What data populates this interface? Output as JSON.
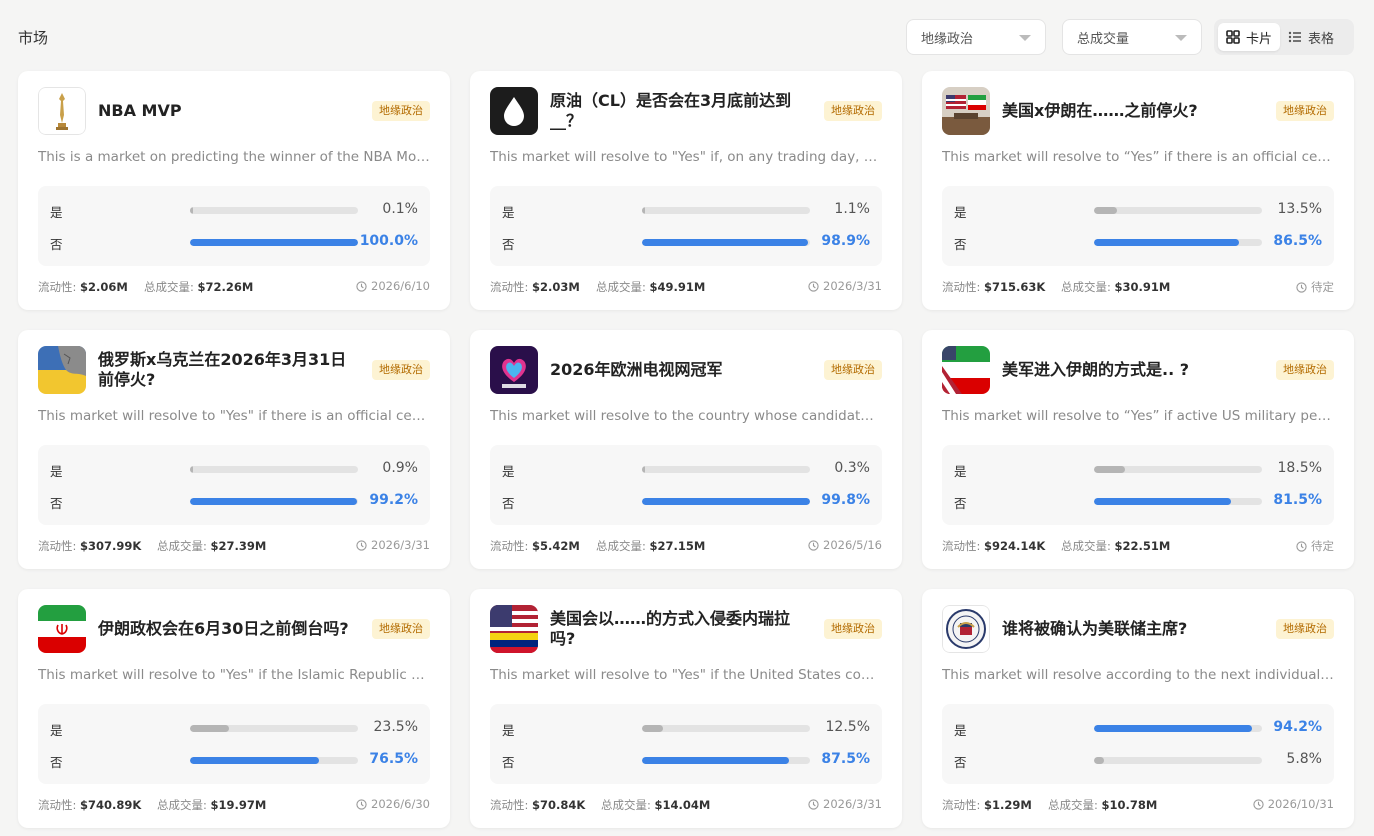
{
  "header": {
    "title": "市场",
    "filter_category": "地缘政治",
    "filter_sort": "总成交量",
    "view_card": "卡片",
    "view_table": "表格"
  },
  "labels": {
    "yes": "是",
    "no": "否",
    "liquidity": "流动性:",
    "volume": "总成交量:"
  },
  "colors": {
    "accent": "#3b82e6",
    "tag_bg": "#fdf3d3",
    "tag_text": "#b36b00"
  },
  "markets": [
    {
      "title": "NBA MVP",
      "tag": "地缘政治",
      "icon": "trophy-icon",
      "desc": "This is a market on predicting the winner of the NBA Most Valuable Player award",
      "yes_pct": "0.1%",
      "no_pct": "100.0%",
      "yes_value": 0.001,
      "no_value": 1.0,
      "liquidity": "$2.06M",
      "volume": "$72.26M",
      "date": "2026/6/10"
    },
    {
      "title": "原油（CL）是否会在3月底前达到__？",
      "tag": "地缘政治",
      "icon": "oil-drop-icon",
      "desc": "This market will resolve to \"Yes\" if, on any trading day, the price reaches",
      "yes_pct": "1.1%",
      "no_pct": "98.9%",
      "yes_value": 0.011,
      "no_value": 0.989,
      "liquidity": "$2.03M",
      "volume": "$49.91M",
      "date": "2026/3/31"
    },
    {
      "title": "美国x伊朗在……之前停火?",
      "tag": "地缘政治",
      "icon": "us-iran-flags-icon",
      "desc": "This market will resolve to “Yes” if there is an official ceasefire",
      "yes_pct": "13.5%",
      "no_pct": "86.5%",
      "yes_value": 0.135,
      "no_value": 0.865,
      "liquidity": "$715.63K",
      "volume": "$30.91M",
      "date": "待定"
    },
    {
      "title": "俄罗斯x乌克兰在2026年3月31日前停火?",
      "tag": "地缘政治",
      "icon": "ukraine-russia-map-icon",
      "desc": "This market will resolve to \"Yes\" if there is an official ceasefire",
      "yes_pct": "0.9%",
      "no_pct": "99.2%",
      "yes_value": 0.009,
      "no_value": 0.992,
      "liquidity": "$307.99K",
      "volume": "$27.39M",
      "date": "2026/3/31"
    },
    {
      "title": "2026年欧洲电视网冠军",
      "tag": "地缘政治",
      "icon": "eurovision-heart-icon",
      "desc": "This market will resolve to the country whose candidate finishes first",
      "yes_pct": "0.3%",
      "no_pct": "99.8%",
      "yes_value": 0.003,
      "no_value": 0.998,
      "liquidity": "$5.42M",
      "volume": "$27.15M",
      "date": "2026/5/16"
    },
    {
      "title": "美军进入伊朗的方式是.. ?",
      "tag": "地缘政治",
      "icon": "us-iran-flag-blend-icon",
      "desc": "This market will resolve to “Yes” if active US military personnel enter",
      "yes_pct": "18.5%",
      "no_pct": "81.5%",
      "yes_value": 0.185,
      "no_value": 0.815,
      "liquidity": "$924.14K",
      "volume": "$22.51M",
      "date": "待定"
    },
    {
      "title": "伊朗政权会在6月30日之前倒台吗?",
      "tag": "地缘政治",
      "icon": "iran-flag-icon",
      "desc": "This market will resolve to \"Yes\" if the Islamic Republic of Iran",
      "yes_pct": "23.5%",
      "no_pct": "76.5%",
      "yes_value": 0.235,
      "no_value": 0.765,
      "liquidity": "$740.89K",
      "volume": "$19.97M",
      "date": "2026/6/30"
    },
    {
      "title": "美国会以……的方式入侵委内瑞拉吗?",
      "tag": "地缘政治",
      "icon": "us-venezuela-flags-icon",
      "desc": "This market will resolve to \"Yes\" if the United States commences",
      "yes_pct": "12.5%",
      "no_pct": "87.5%",
      "yes_value": 0.125,
      "no_value": 0.875,
      "liquidity": "$70.84K",
      "volume": "$14.04M",
      "date": "2026/3/31"
    },
    {
      "title": "谁将被确认为美联储主席?",
      "tag": "地缘政治",
      "icon": "federal-reserve-seal-icon",
      "desc": "This market will resolve according to the next individual formally confirmed",
      "yes_pct": "94.2%",
      "no_pct": "5.8%",
      "yes_value": 0.942,
      "no_value": 0.058,
      "liquidity": "$1.29M",
      "volume": "$10.78M",
      "date": "2026/10/31"
    }
  ]
}
